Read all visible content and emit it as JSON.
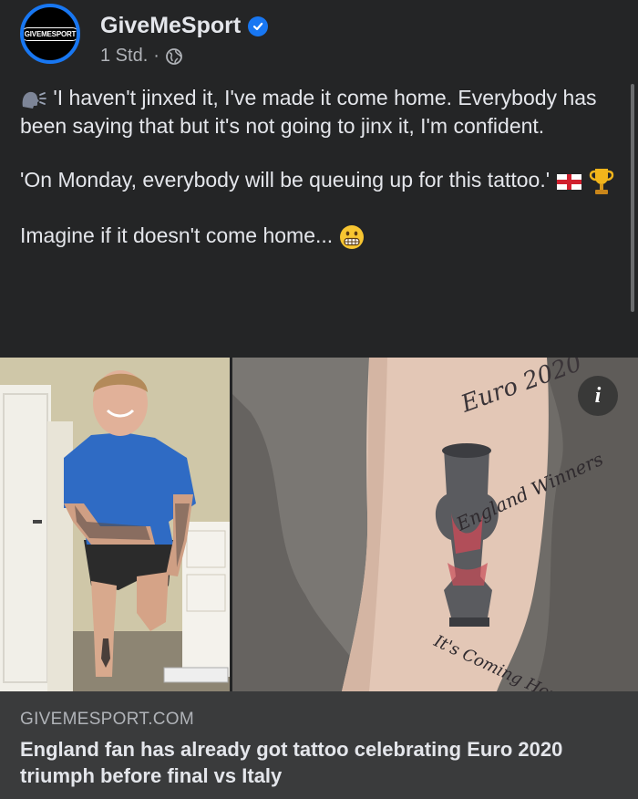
{
  "post": {
    "page_name": "GiveMeSport",
    "avatar_logo_text": "GIVEMESPORT",
    "timestamp": "1 Std.",
    "separator": "·",
    "audience_icon": "globe-icon",
    "text": {
      "quote_1": "'I haven't jinxed it, I've made it come home. Everybody has been saying that but it's not going to jinx it, I'm confident.",
      "quote_2": "'On Monday, everybody will be queuing up for this tattoo.'",
      "quote_3": "Imagine if it doesn't come home..."
    }
  },
  "images": {
    "tattoo_text_top": "Euro 2020",
    "tattoo_text_mid": "England Winners",
    "tattoo_text_bottom": "It's Coming Home!",
    "info_label": "i"
  },
  "link_preview": {
    "domain": "GIVEMESPORT.COM",
    "title": "England fan has already got tattoo celebrating Euro 2020 triumph before final vs Italy"
  },
  "colors": {
    "background": "#242526",
    "link_box": "#3a3b3c",
    "verified": "#1877f2",
    "text": "#e4e6eb",
    "secondary": "#b0b3b8"
  }
}
